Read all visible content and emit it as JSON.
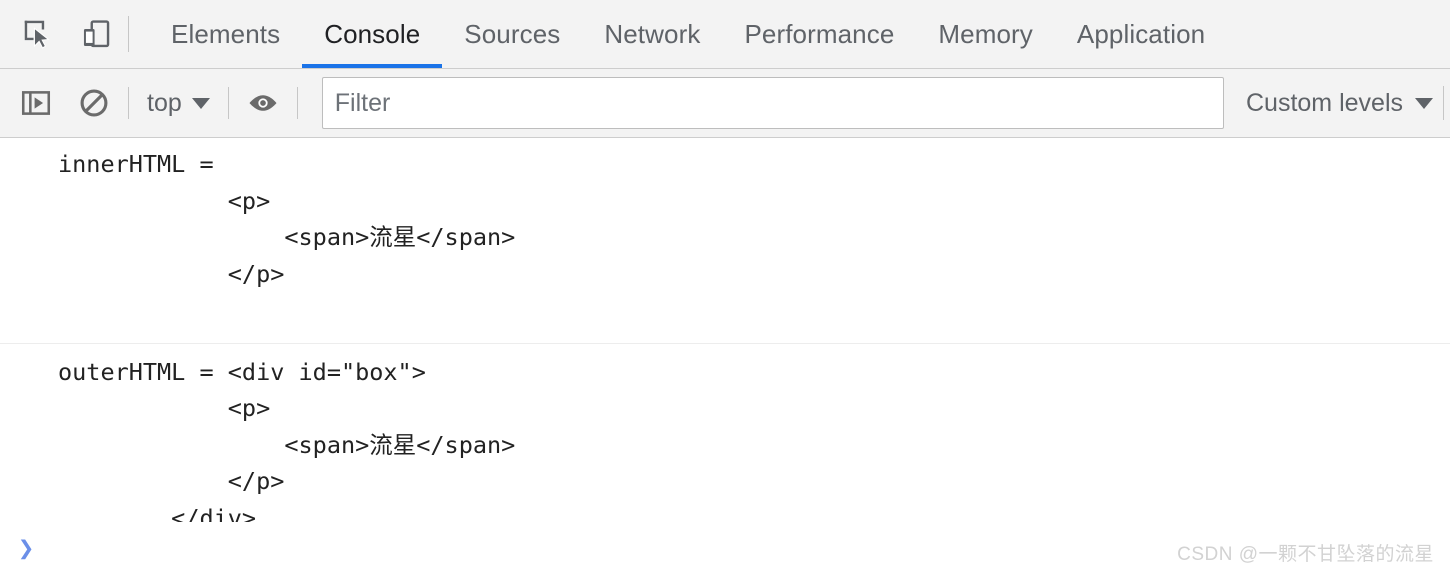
{
  "tabbar": {
    "icons": [
      {
        "name": "inspect-element-icon",
        "label": "Inspect element"
      },
      {
        "name": "device-toolbar-icon",
        "label": "Toggle device toolbar"
      }
    ],
    "tabs": [
      {
        "label": "Elements",
        "active": false
      },
      {
        "label": "Console",
        "active": true
      },
      {
        "label": "Sources",
        "active": false
      },
      {
        "label": "Network",
        "active": false
      },
      {
        "label": "Performance",
        "active": false
      },
      {
        "label": "Memory",
        "active": false
      },
      {
        "label": "Application",
        "active": false
      }
    ],
    "active_tab": "Console",
    "active_underline_color": "#1a73e8"
  },
  "console_toolbar": {
    "sidebar_toggle_label": "Show console sidebar",
    "clear_console_label": "Clear console",
    "context": "top",
    "eye_label": "Create live expression",
    "filter": {
      "value": "",
      "placeholder": "Filter"
    },
    "levels": "Custom levels"
  },
  "console_messages": [
    {
      "id": "innerHTML-message",
      "text": "innerHTML = \n            <p>\n                <span>流星</span>\n            </p>\n        "
    },
    {
      "id": "outerHTML-message",
      "text": "outerHTML = <div id=\"box\">\n            <p>\n                <span>流星</span>\n            </p>\n        </div>"
    }
  ],
  "prompt": {
    "chevron": "❯"
  },
  "watermark": {
    "text": "CSDN @一颗不甘坠落的流星"
  },
  "colors": {
    "toolbar_bg": "#f3f3f3",
    "accent": "#1a73e8",
    "text": "#5f6368",
    "console_text": "#222222",
    "prompt": "#6b8fe8",
    "watermark": "#d2d2d2"
  }
}
